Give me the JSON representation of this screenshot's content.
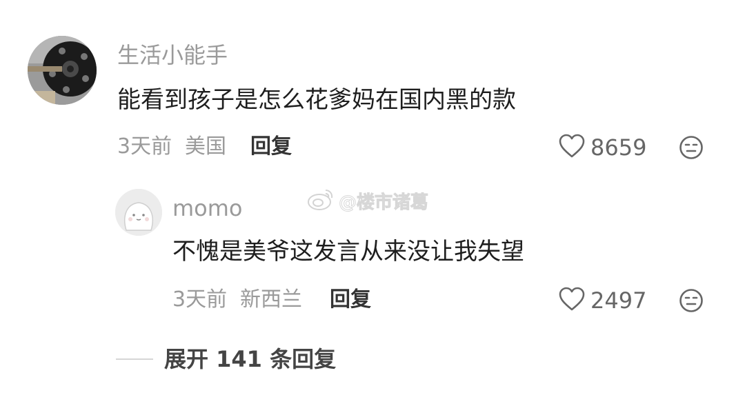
{
  "comment": {
    "username": "生活小能手",
    "text": "能看到孩子是怎么花爹妈在国内黑的款",
    "time": "3天前",
    "location": "美国",
    "reply_label": "回复",
    "likes": "8659"
  },
  "reply": {
    "username": "momo",
    "text": "不愧是美爷这发言从来没让我失望",
    "time": "3天前",
    "location": "新西兰",
    "reply_label": "回复",
    "likes": "2497"
  },
  "watermark": {
    "text": "@楼市诸葛"
  },
  "expand": {
    "label": "展开 141 条回复"
  },
  "icons": {
    "like": "heart-outline-icon",
    "emoji": "expressionless-face-icon",
    "watermark_logo": "weibo-logo"
  },
  "colors": {
    "username": "#9a9a9a",
    "text": "#1e1e1e",
    "meta": "#9a9a9a",
    "reply": "#333333"
  }
}
